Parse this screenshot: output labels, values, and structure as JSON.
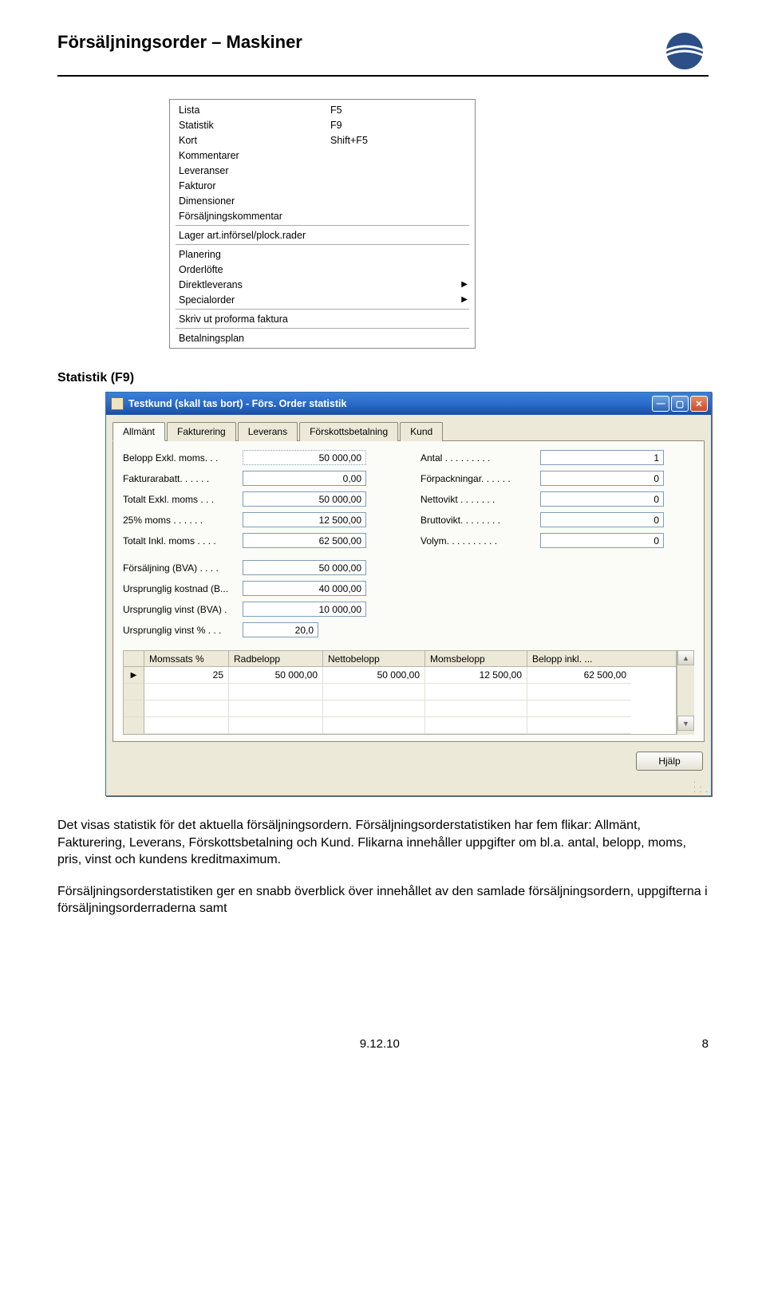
{
  "header": {
    "title": "Försäljningsorder – Maskiner"
  },
  "context_menu": {
    "group1": [
      {
        "label": "Lista",
        "shortcut": "F5"
      },
      {
        "label": "Statistik",
        "shortcut": "F9"
      },
      {
        "label": "Kort",
        "shortcut": "Shift+F5"
      },
      {
        "label": "Kommentarer",
        "shortcut": ""
      },
      {
        "label": "Leveranser",
        "shortcut": ""
      },
      {
        "label": "Fakturor",
        "shortcut": ""
      },
      {
        "label": "Dimensioner",
        "shortcut": ""
      },
      {
        "label": "Försäljningskommentar",
        "shortcut": ""
      }
    ],
    "group2": [
      {
        "label": "Lager art.införsel/plock.rader",
        "shortcut": ""
      }
    ],
    "group3": [
      {
        "label": "Planering",
        "shortcut": ""
      },
      {
        "label": "Orderlöfte",
        "shortcut": ""
      },
      {
        "label": "Direktleverans",
        "shortcut": "",
        "submenu": true
      },
      {
        "label": "Specialorder",
        "shortcut": "",
        "submenu": true
      }
    ],
    "group4": [
      {
        "label": "Skriv ut proforma faktura",
        "shortcut": ""
      }
    ],
    "group5": [
      {
        "label": "Betalningsplan",
        "shortcut": ""
      }
    ]
  },
  "section": {
    "title": "Statistik (F9)"
  },
  "window": {
    "title": "Testkund (skall tas bort) - Förs. Order statistik",
    "tabs": [
      "Allmänt",
      "Fakturering",
      "Leverans",
      "Förskottsbetalning",
      "Kund"
    ],
    "active_tab": 0,
    "left_fields": [
      {
        "label": "Belopp Exkl. moms. . .",
        "value": "50 000,00"
      },
      {
        "label": "Fakturarabatt. . . . . .",
        "value": "0,00"
      },
      {
        "label": "Totalt Exkl. moms . . .",
        "value": "50 000,00"
      },
      {
        "label": "25% moms  . . . . . .",
        "value": "12 500,00"
      },
      {
        "label": "Totalt Inkl. moms . . . .",
        "value": "62 500,00"
      },
      {
        "label": "Försäljning (BVA) . . . .",
        "value": "50 000,00"
      },
      {
        "label": "Ursprunglig kostnad (B...",
        "value": "40 000,00"
      },
      {
        "label": "Ursprunglig vinst (BVA)   .",
        "value": "10 000,00"
      },
      {
        "label": "Ursprunglig vinst % . . .",
        "value": "20,0"
      }
    ],
    "right_fields": [
      {
        "label": "Antal . . . . . . . . .",
        "value": "1"
      },
      {
        "label": "Förpackningar. . . . . .",
        "value": "0"
      },
      {
        "label": "Nettovikt . . . . . . .",
        "value": "0"
      },
      {
        "label": "Bruttovikt. . . . . . . .",
        "value": "0"
      },
      {
        "label": "Volym. . . . . . . . . .",
        "value": "0"
      }
    ],
    "grid": {
      "columns": [
        "Momssats %",
        "Radbelopp",
        "Nettobelopp",
        "Momsbelopp",
        "Belopp inkl. ..."
      ],
      "rows": [
        [
          "25",
          "50 000,00",
          "50 000,00",
          "12 500,00",
          "62 500,00"
        ]
      ],
      "empty_rows": 3
    },
    "help_label": "Hjälp"
  },
  "body": {
    "p1": "Det visas statistik för det aktuella försäljningsordern. Försäljningsorderstatistiken har fem flikar: Allmänt, Fakturering, Leverans, Förskottsbetalning och Kund. Flikarna innehåller uppgifter om bl.a. antal, belopp, moms, pris, vinst och kundens kreditmaximum.",
    "p2": "Försäljningsorderstatistiken ger en snabb överblick över innehållet av den samlade försäljningsordern, uppgifterna i försäljningsorderraderna samt"
  },
  "footer": {
    "date": "9.12.10",
    "page": "8"
  }
}
